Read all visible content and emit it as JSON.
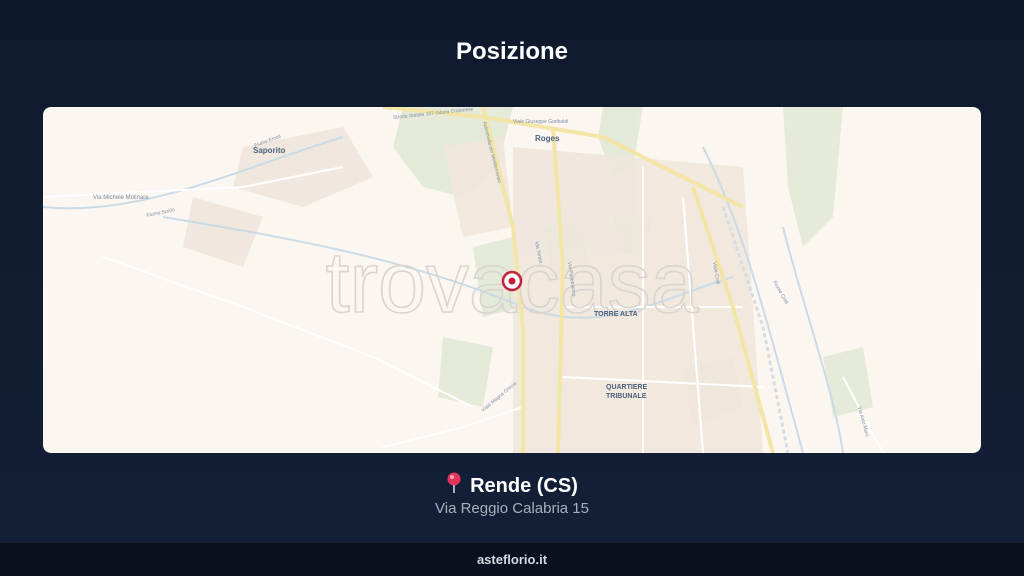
{
  "title": "Posizione",
  "map": {
    "watermark": "trovacasa",
    "labels": {
      "saporito": "Saporito",
      "roges": "Roges",
      "torre_alta": "TORRE ALTA",
      "quartiere_line1": "QUARTIERE",
      "quartiere_line2": "TRIBUNALE",
      "via_molinare": "Via Michele Molinare",
      "fiume_surdo": "Fiume Surdo",
      "fiume_emoli": "Fiume Emoli",
      "statale": "Strada Statale 107 Silana Crotonese",
      "autostrada": "Autostrada del Mediterraneo",
      "garibaldi": "Viale Giuseppe Garibaldi",
      "via_torino": "Via Torino",
      "via_panebianco": "Via Panebianco",
      "magna_grecia": "Viale Magna Grecia",
      "via_crati": "Viale Crati",
      "fiume_crati": "Fiume Crati",
      "aldo_moro": "Via Aldo Moro"
    }
  },
  "location": {
    "city": "Rende (CS)",
    "address": "Via Reggio Calabria 15"
  },
  "footer": {
    "site": "asteflorio.it"
  }
}
